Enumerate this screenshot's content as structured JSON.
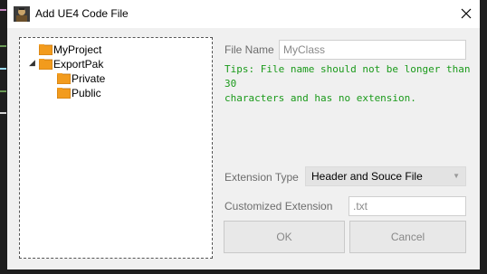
{
  "window": {
    "title": "Add UE4 Code File",
    "close_glyph": "close-icon"
  },
  "tree": {
    "items": [
      {
        "label": "MyProject",
        "icon": "folder-icon",
        "expanded": null
      },
      {
        "label": "ExportPak",
        "icon": "folder-icon",
        "expanded": true
      },
      {
        "label": "Private",
        "icon": "folder-icon",
        "expanded": null
      },
      {
        "label": "Public",
        "icon": "folder-icon",
        "expanded": null
      }
    ],
    "expander_glyph": "◢"
  },
  "form": {
    "file_name_label": "File Name",
    "file_name_value": "MyClass",
    "tips_line1": "Tips: File name should not be longer than 30",
    "tips_line2": "characters and has no extension.",
    "extension_type_label": "Extension Type",
    "extension_type_value": "Header and Souce File",
    "customized_extension_label": "Customized Extension",
    "customized_extension_value": ".txt"
  },
  "buttons": {
    "ok": "OK",
    "cancel": "Cancel"
  },
  "colors": {
    "tips": "#1a9a1a",
    "folder": "#f29b1d",
    "window_bg": "#f0f0f0"
  }
}
